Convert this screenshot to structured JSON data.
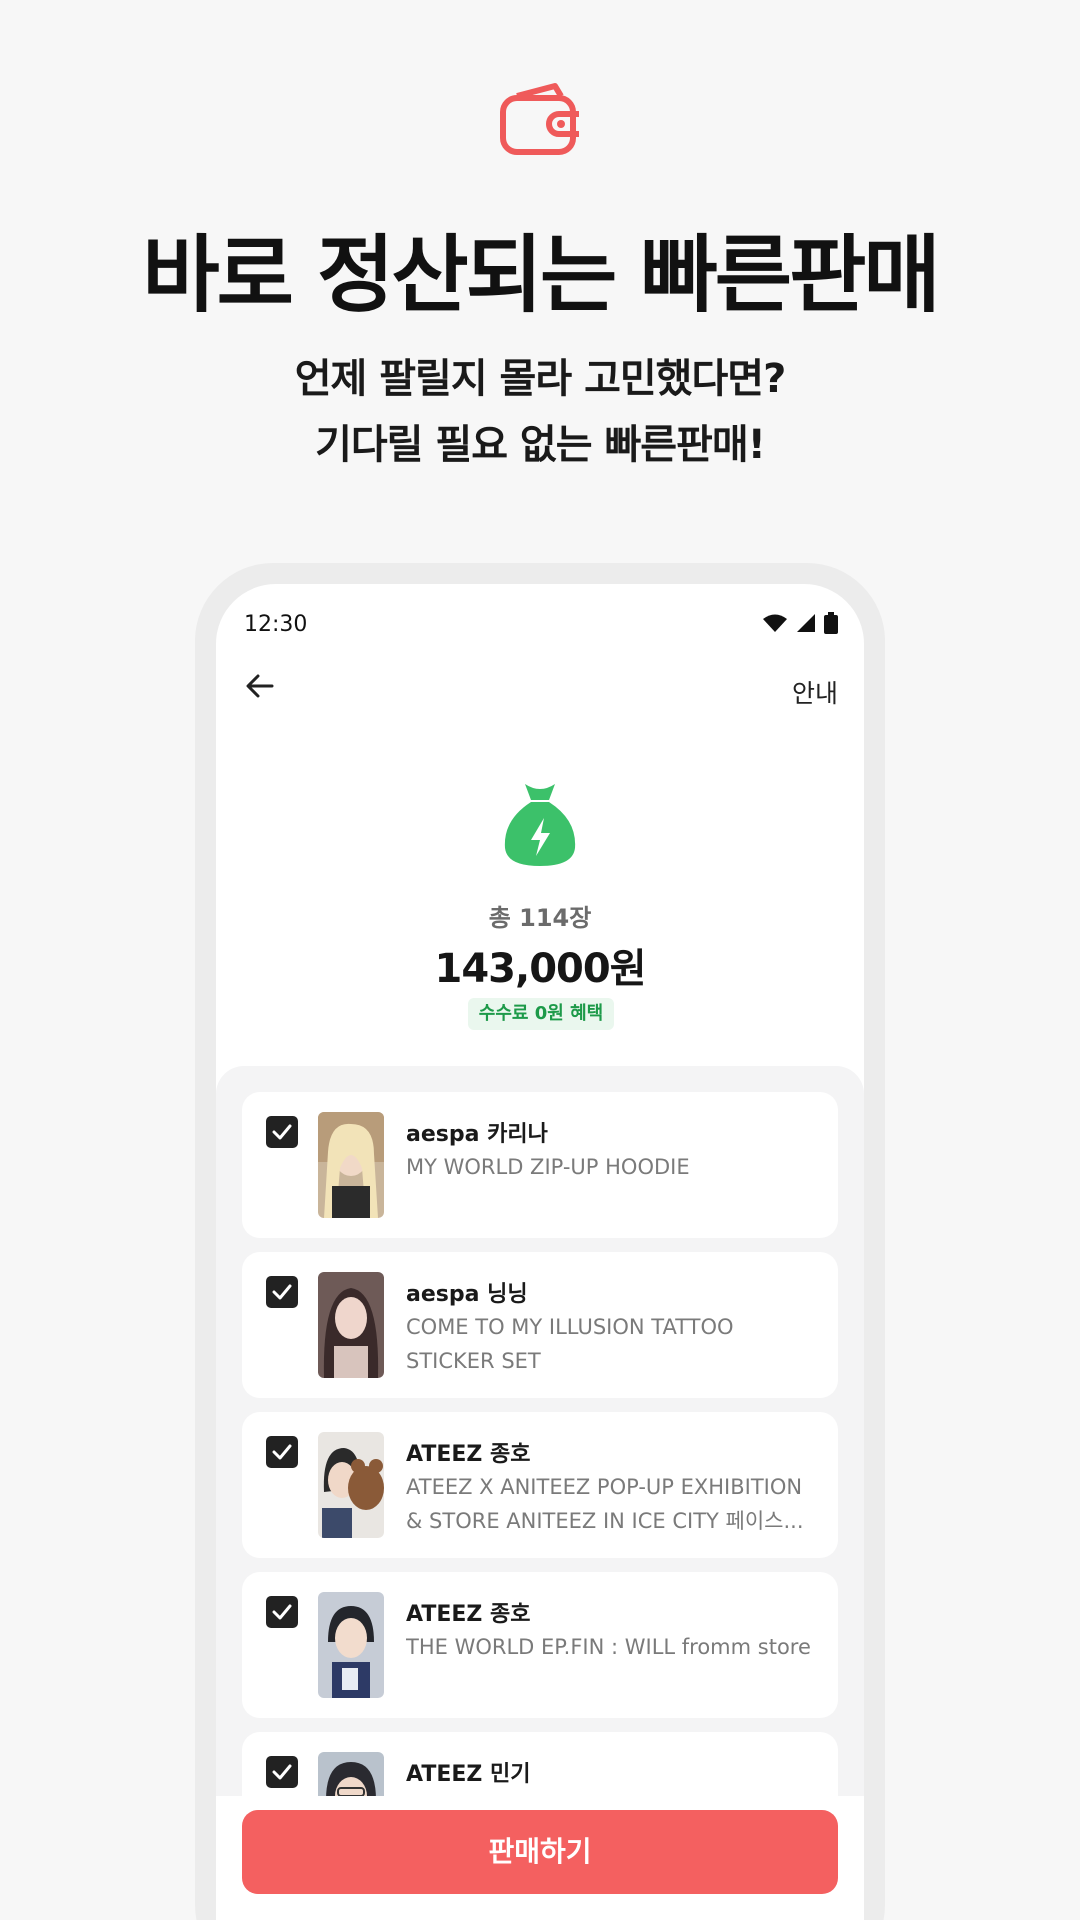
{
  "hero": {
    "headline": "바로 정산되는 빠른판매",
    "sub_line1": "언제 팔릴지 몰라 고민했다면?",
    "sub_line2": "기다릴 필요 없는 빠른판매!",
    "icon": "wallet-icon",
    "accent": "#ef5a5a"
  },
  "status_bar": {
    "time": "12:30"
  },
  "header": {
    "info_label": "안내"
  },
  "summary": {
    "icon": "money-bag-icon",
    "count_label": "총 114장",
    "amount": "143,000원",
    "badge": "수수료 0원 혜택"
  },
  "items": [
    {
      "artist": "aespa 카리나",
      "title": "MY WORLD ZIP-UP HOODIE",
      "checked": true
    },
    {
      "artist": "aespa 닝닝",
      "title": "COME TO MY ILLUSION TATTOO STICKER SET",
      "checked": true
    },
    {
      "artist": "ATEEZ 종호",
      "title": "ATEEZ X ANITEEZ POP-UP EXHIBITION & STORE ANITEEZ IN ICE CITY 페이스...",
      "checked": true
    },
    {
      "artist": "ATEEZ 종호",
      "title": "THE WORLD EP.FIN : WILL fromm store",
      "checked": true
    },
    {
      "artist": "ATEEZ 민기",
      "title": "",
      "checked": true
    }
  ],
  "cta": {
    "label": "판매하기",
    "color": "#f46060"
  }
}
